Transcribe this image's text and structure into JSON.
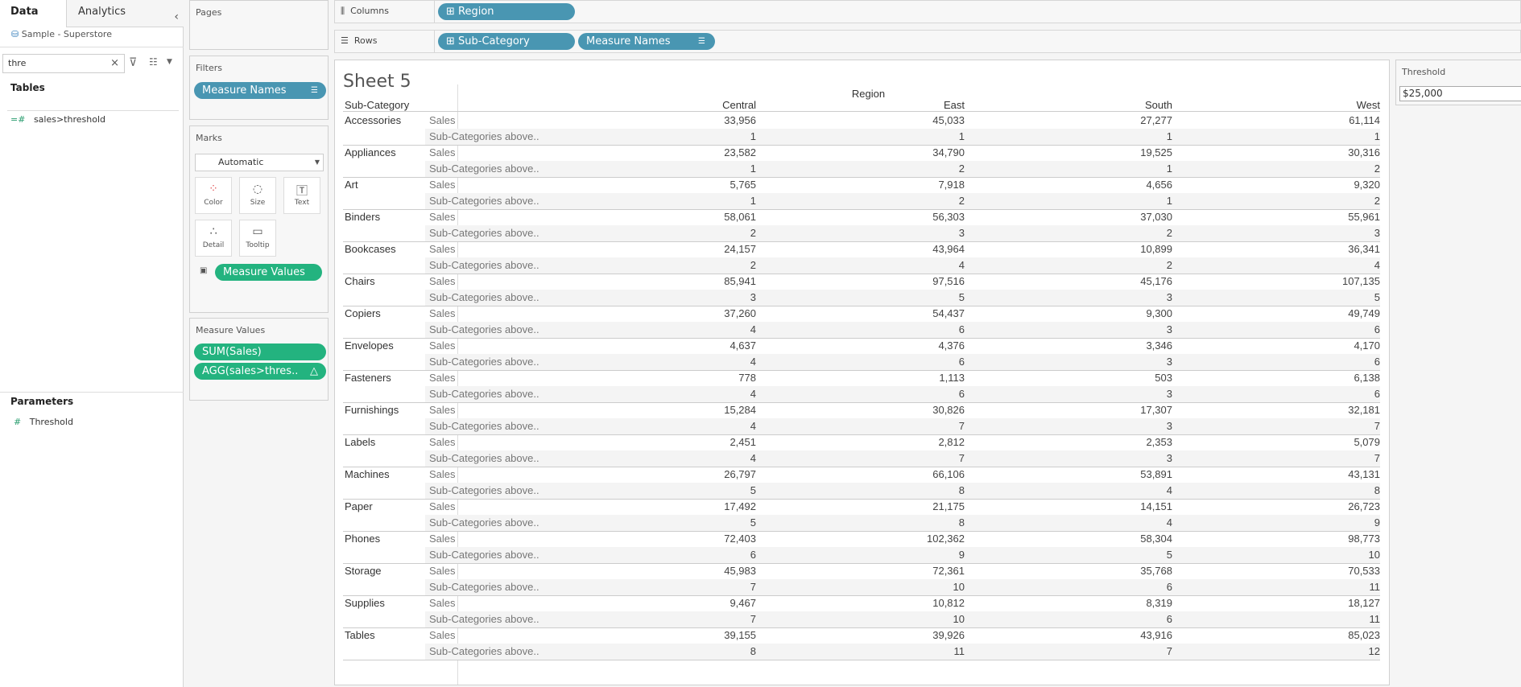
{
  "left_pane": {
    "tab_data": "Data",
    "tab_analytics": "Analytics",
    "datasource": "Sample - Superstore",
    "search_value": "thre",
    "tables_heading": "Tables",
    "fields": [
      "sales>threshold"
    ],
    "parameters_heading": "Parameters",
    "parameters": [
      "Threshold"
    ]
  },
  "cards": {
    "pages": "Pages",
    "filters": "Filters",
    "filter_pills": [
      "Measure Names"
    ],
    "marks": "Marks",
    "mark_type": "Automatic",
    "mark_buttons": [
      "Color",
      "Size",
      "Text",
      "Detail",
      "Tooltip"
    ],
    "marks_pill": "Measure Values",
    "measure_values_title": "Measure Values",
    "measure_values_pills": [
      "SUM(Sales)",
      "AGG(sales>thres.."
    ]
  },
  "shelves": {
    "columns_label": "Columns",
    "columns_pills": [
      "Region"
    ],
    "rows_label": "Rows",
    "rows_pills": [
      "Sub-Category",
      "Measure Names"
    ]
  },
  "sheet": {
    "title": "Sheet 5",
    "column_group": "Region",
    "row_header": "Sub-Category",
    "regions": [
      "Central",
      "East",
      "South",
      "West"
    ],
    "measures": [
      "Sales",
      "Sub-Categories above.."
    ],
    "rows": [
      {
        "name": "Accessories",
        "sales": [
          "33,956",
          "45,033",
          "27,277",
          "61,114"
        ],
        "count": [
          "1",
          "1",
          "1",
          "1"
        ]
      },
      {
        "name": "Appliances",
        "sales": [
          "23,582",
          "34,790",
          "19,525",
          "30,316"
        ],
        "count": [
          "1",
          "2",
          "1",
          "2"
        ]
      },
      {
        "name": "Art",
        "sales": [
          "5,765",
          "7,918",
          "4,656",
          "9,320"
        ],
        "count": [
          "1",
          "2",
          "1",
          "2"
        ]
      },
      {
        "name": "Binders",
        "sales": [
          "58,061",
          "56,303",
          "37,030",
          "55,961"
        ],
        "count": [
          "2",
          "3",
          "2",
          "3"
        ]
      },
      {
        "name": "Bookcases",
        "sales": [
          "24,157",
          "43,964",
          "10,899",
          "36,341"
        ],
        "count": [
          "2",
          "4",
          "2",
          "4"
        ]
      },
      {
        "name": "Chairs",
        "sales": [
          "85,941",
          "97,516",
          "45,176",
          "107,135"
        ],
        "count": [
          "3",
          "5",
          "3",
          "5"
        ]
      },
      {
        "name": "Copiers",
        "sales": [
          "37,260",
          "54,437",
          "9,300",
          "49,749"
        ],
        "count": [
          "4",
          "6",
          "3",
          "6"
        ]
      },
      {
        "name": "Envelopes",
        "sales": [
          "4,637",
          "4,376",
          "3,346",
          "4,170"
        ],
        "count": [
          "4",
          "6",
          "3",
          "6"
        ]
      },
      {
        "name": "Fasteners",
        "sales": [
          "778",
          "1,113",
          "503",
          "6,138"
        ],
        "count": [
          "4",
          "6",
          "3",
          "6"
        ]
      },
      {
        "name": "Furnishings",
        "sales": [
          "15,284",
          "30,826",
          "17,307",
          "32,181"
        ],
        "count": [
          "4",
          "7",
          "3",
          "7"
        ]
      },
      {
        "name": "Labels",
        "sales": [
          "2,451",
          "2,812",
          "2,353",
          "5,079"
        ],
        "count": [
          "4",
          "7",
          "3",
          "7"
        ]
      },
      {
        "name": "Machines",
        "sales": [
          "26,797",
          "66,106",
          "53,891",
          "43,131"
        ],
        "count": [
          "5",
          "8",
          "4",
          "8"
        ]
      },
      {
        "name": "Paper",
        "sales": [
          "17,492",
          "21,175",
          "14,151",
          "26,723"
        ],
        "count": [
          "5",
          "8",
          "4",
          "9"
        ]
      },
      {
        "name": "Phones",
        "sales": [
          "72,403",
          "102,362",
          "58,304",
          "98,773"
        ],
        "count": [
          "6",
          "9",
          "5",
          "10"
        ]
      },
      {
        "name": "Storage",
        "sales": [
          "45,983",
          "72,361",
          "35,768",
          "70,533"
        ],
        "count": [
          "7",
          "10",
          "6",
          "11"
        ]
      },
      {
        "name": "Supplies",
        "sales": [
          "9,467",
          "10,812",
          "8,319",
          "18,127"
        ],
        "count": [
          "7",
          "10",
          "6",
          "11"
        ]
      },
      {
        "name": "Tables",
        "sales": [
          "39,155",
          "39,926",
          "43,916",
          "85,023"
        ],
        "count": [
          "8",
          "11",
          "7",
          "12"
        ]
      }
    ]
  },
  "parameter_card": {
    "title": "Threshold",
    "value": "$25,000"
  }
}
